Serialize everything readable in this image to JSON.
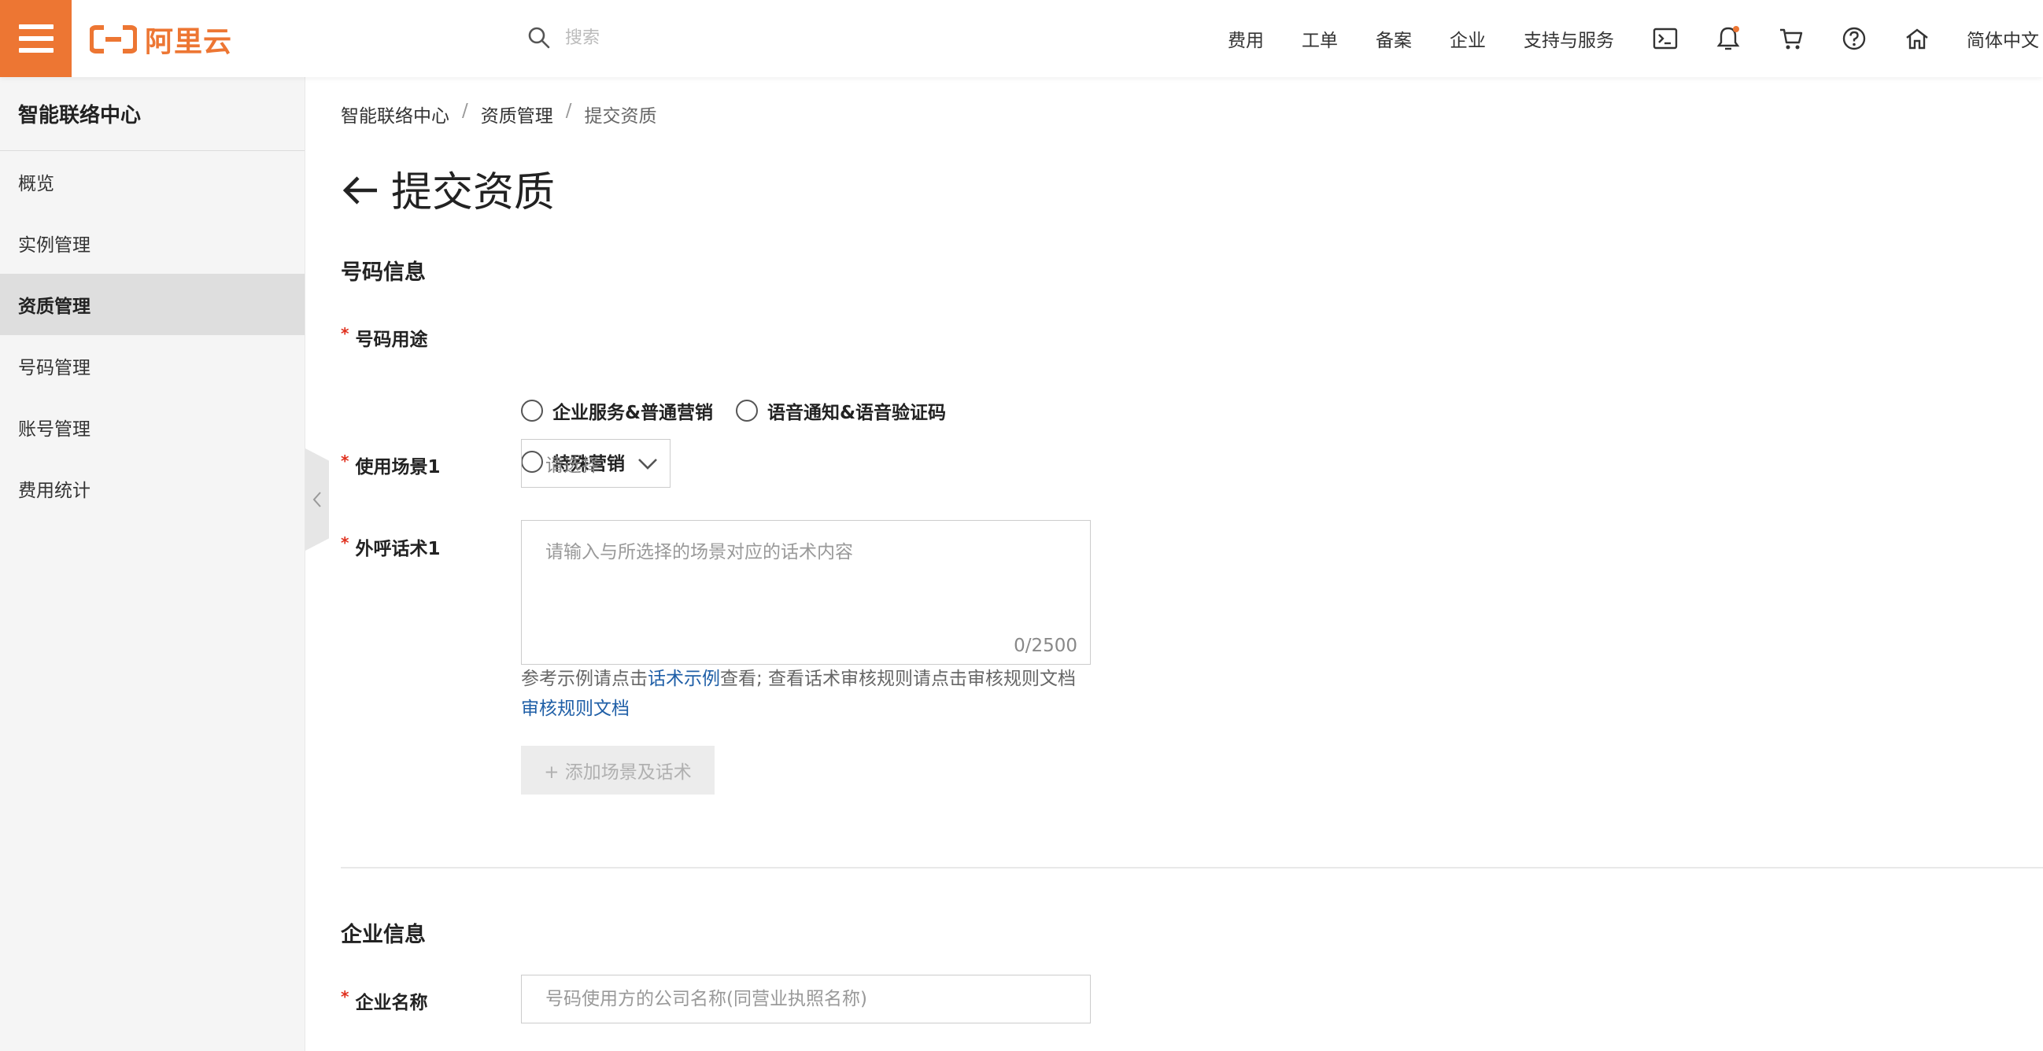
{
  "brand": {
    "name": "阿里云",
    "accent": "#ed7633"
  },
  "topbar": {
    "search_placeholder": "搜索",
    "nav": [
      "费用",
      "工单",
      "备案",
      "企业",
      "支持与服务"
    ],
    "language": "简体中文",
    "icons": [
      "terminal-icon",
      "bell-icon",
      "cart-icon",
      "help-icon",
      "home-icon"
    ]
  },
  "sidebar": {
    "title": "智能联络中心",
    "items": [
      {
        "label": "概览"
      },
      {
        "label": "实例管理"
      },
      {
        "label": "资质管理",
        "active": true
      },
      {
        "label": "号码管理"
      },
      {
        "label": "账号管理"
      },
      {
        "label": "费用统计"
      }
    ]
  },
  "breadcrumb": [
    "智能联络中心",
    "资质管理",
    "提交资质"
  ],
  "page": {
    "title": "提交资质"
  },
  "form": {
    "number_section": "号码信息",
    "usage_label": "号码用途",
    "usage_options": [
      "企业服务&普通营销",
      "语音通知&语音验证码",
      "特殊营销"
    ],
    "scene_label": "使用场景1",
    "scene_placeholder": "请选择",
    "script_label": "外呼话术1",
    "script_placeholder": "请输入与所选择的场景对应的话术内容",
    "script_counter": "0/2500",
    "hint_prefix": "参考示例请点击",
    "hint_link1": "话术示例",
    "hint_middle": "查看; 查看话术审核规则请点击审核规则文档",
    "hint_link2": "审核规则文档",
    "add_button": "+ 添加场景及话术",
    "company_section": "企业信息",
    "company_label": "企业名称",
    "company_placeholder": "号码使用方的公司名称(同营业执照名称)"
  }
}
